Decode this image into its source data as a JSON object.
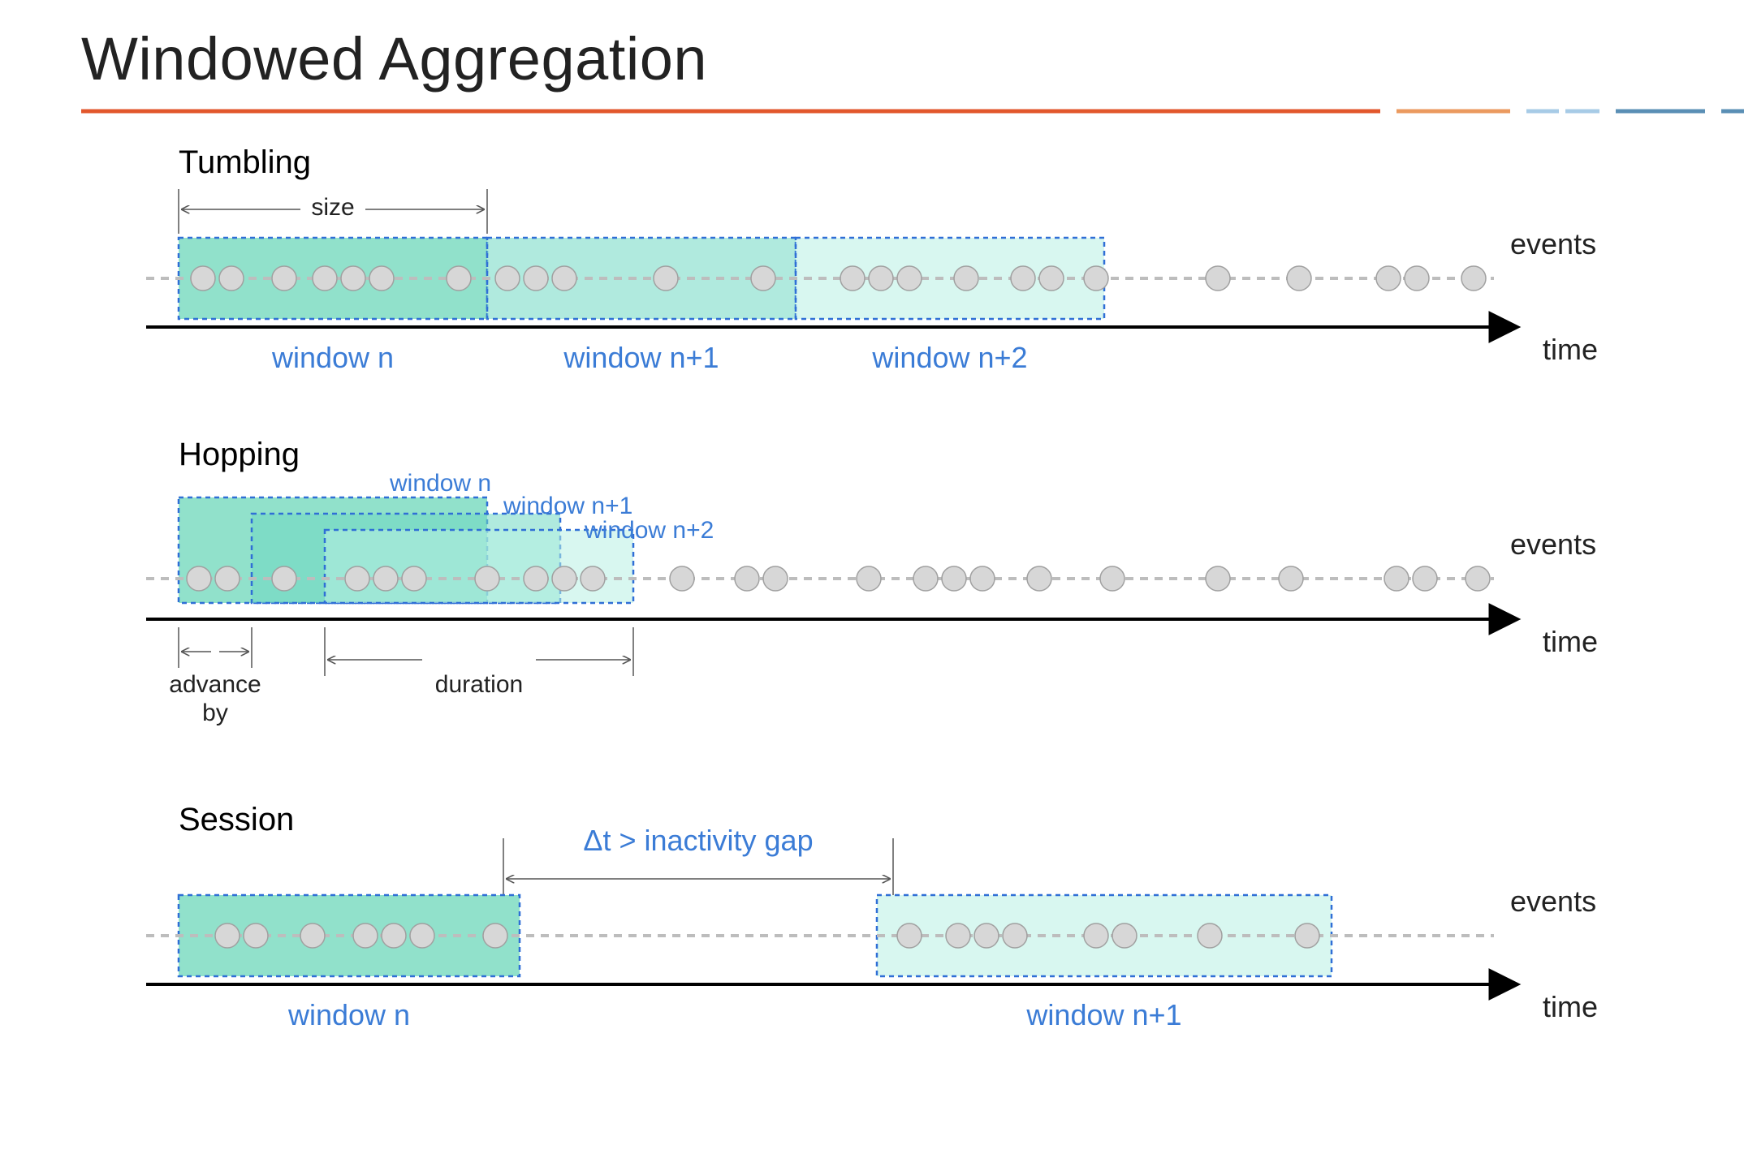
{
  "title": "Windowed Aggregation",
  "colors": {
    "accentOrange": "#e2572c",
    "accentOrangeLight": "#eb9a5f",
    "accentBlueLight": "#a7cbe6",
    "accentBlue": "#5a8fb5",
    "windowFill1": "#36c9a0",
    "windowFill2": "#6fd9c3",
    "windowFill3": "#b8f0e4",
    "blueText": "#3b7cd6"
  },
  "sections": {
    "tumbling": {
      "heading": "Tumbling",
      "sizeLabel": "size",
      "eventsLabel": "events",
      "timeLabel": "time",
      "windows": [
        "window n",
        "window n+1",
        "window n+2"
      ]
    },
    "hopping": {
      "heading": "Hopping",
      "eventsLabel": "events",
      "timeLabel": "time",
      "advanceLabel1": "advance",
      "advanceLabel2": "by",
      "durationLabel": "duration",
      "windows": [
        "window n",
        "window n+1",
        "window n+2"
      ]
    },
    "session": {
      "heading": "Session",
      "eventsLabel": "events",
      "timeLabel": "time",
      "gapLabel": "Δt > inactivity gap",
      "windows": [
        "window n",
        "window n+1"
      ]
    }
  }
}
